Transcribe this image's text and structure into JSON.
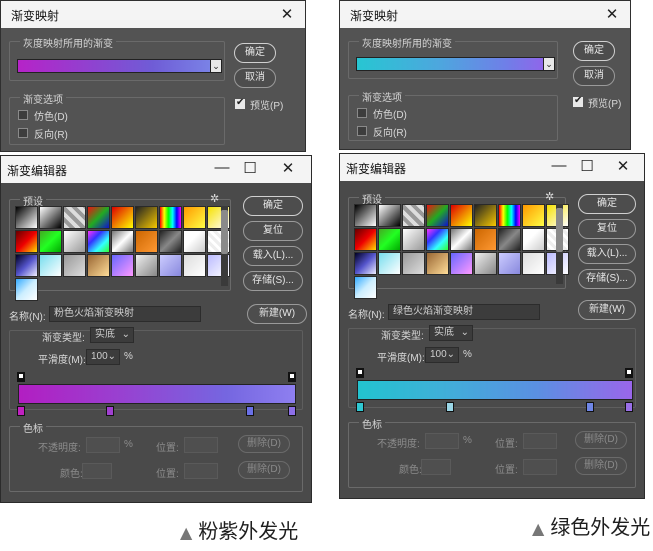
{
  "left": {
    "gradient_map": {
      "title": "渐变映射",
      "group_label": "灰度映射所用的渐变",
      "gradient_css": "linear-gradient(90deg, #b623c8 0%, #6f5cd6 70%, #7a82e6 100%)",
      "options_label": "渐变选项",
      "dither_label": "仿色(D)",
      "reverse_label": "反向(R)",
      "ok_label": "确定",
      "cancel_label": "取消",
      "preview_label": "预览(P)"
    },
    "gradient_editor": {
      "title": "渐变编辑器",
      "presets_label": "预设",
      "ok_label": "确定",
      "reset_label": "复位",
      "load_label": "载入(L)...",
      "save_label": "存储(S)...",
      "name_label": "名称(N):",
      "name_value": "粉色火焰渐变映射",
      "new_label": "新建(W)",
      "type_label": "渐变类型:",
      "type_value": "实底",
      "smooth_label": "平滑度(M):",
      "smooth_value": "100",
      "smooth_unit": "%",
      "gradient_css": "linear-gradient(90deg, #b21ec2 0%, #9a3fd0 35%, #7566e0 75%, #8e7ff0 100%)",
      "stops_color": [
        "#c020c0",
        "#a040d0",
        "#6a70e6",
        "#8d6fe8"
      ],
      "stops_label": "色标",
      "opacity_label": "不透明度:",
      "opacity_unit": "%",
      "position_label": "位置:",
      "delete_label": "删除(D)",
      "color_label": "颜色:"
    },
    "caption": "粉紫外发光"
  },
  "right": {
    "gradient_map": {
      "title": "渐变映射",
      "group_label": "灰度映射所用的渐变",
      "gradient_css": "linear-gradient(90deg, #27c6d2 0%, #4ea6de 45%, #6f7fe8 80%, #8f66ea 100%)",
      "options_label": "渐变选项",
      "dither_label": "仿色(D)",
      "reverse_label": "反向(R)",
      "ok_label": "确定",
      "cancel_label": "取消",
      "preview_label": "预览(P)"
    },
    "gradient_editor": {
      "title": "渐变编辑器",
      "presets_label": "预设",
      "ok_label": "确定",
      "reset_label": "复位",
      "load_label": "载入(L)...",
      "save_label": "存储(S)...",
      "name_label": "名称(N):",
      "name_value": "绿色火焰渐变映射",
      "new_label": "新建(W)",
      "type_label": "渐变类型:",
      "type_value": "实底",
      "smooth_label": "平滑度(M):",
      "smooth_value": "100",
      "smooth_unit": "%",
      "gradient_css": "linear-gradient(90deg, #22c3cf 0%, #3fb0d8 30%, #5a90e2 65%, #9a66ea 100%)",
      "stops_color": [
        "#2fc8d2",
        "#9ad6e6",
        "#6f86e6",
        "#9a6fe8"
      ],
      "stops_label": "色标",
      "opacity_label": "不透明度:",
      "opacity_unit": "%",
      "position_label": "位置:",
      "delete_label": "删除(D)",
      "color_label": "颜色:"
    },
    "caption": "绿色外发光"
  },
  "preset_swatches": [
    "linear-gradient(135deg,#000,#fff)",
    "linear-gradient(135deg,#fff 0%,#000 100%)",
    "repeating-linear-gradient(45deg,#ddd 0 4px,#999 4px 8px)",
    "linear-gradient(135deg,#e11,#2a2,#11c)",
    "linear-gradient(135deg,#d00,#ff0)",
    "linear-gradient(135deg,#222,#f7c800)",
    "linear-gradient(90deg,#f00,#ff0,#0f0,#0ff,#00f,#f0f)",
    "linear-gradient(135deg,#f90,#ff4)",
    "linear-gradient(135deg,#f6e100,#ffffff)",
    "linear-gradient(135deg,#600,#e00,#fd0)",
    "linear-gradient(135deg,#4a2,#2f2,#0a0)",
    "linear-gradient(135deg,#fff,#999)",
    "linear-gradient(135deg,#f3f,#33f,#3ff,#3f3)",
    "linear-gradient(135deg,#777,#fff,#777)",
    "linear-gradient(135deg,#c60,#f93)",
    "linear-gradient(135deg,#222,#888,#222)",
    "linear-gradient(135deg,#fff 40%,#ccc)",
    "repeating-linear-gradient(45deg,#eee 0 3px,#fff 3px 6px)",
    "linear-gradient(135deg,#002,#55c,#eef)",
    "linear-gradient(135deg,#7de,#fff)",
    "linear-gradient(135deg,#999,#ddd)",
    "linear-gradient(135deg,#963,#fd9)",
    "linear-gradient(135deg,#66f,#f9f)",
    "linear-gradient(135deg,#eee,#888)",
    "linear-gradient(135deg,#ccf,#88d)",
    "linear-gradient(135deg,#ddd,#fff)",
    "linear-gradient(135deg,#bbf,#fff)",
    "linear-gradient(135deg,#3af,#cef,#fff)"
  ]
}
